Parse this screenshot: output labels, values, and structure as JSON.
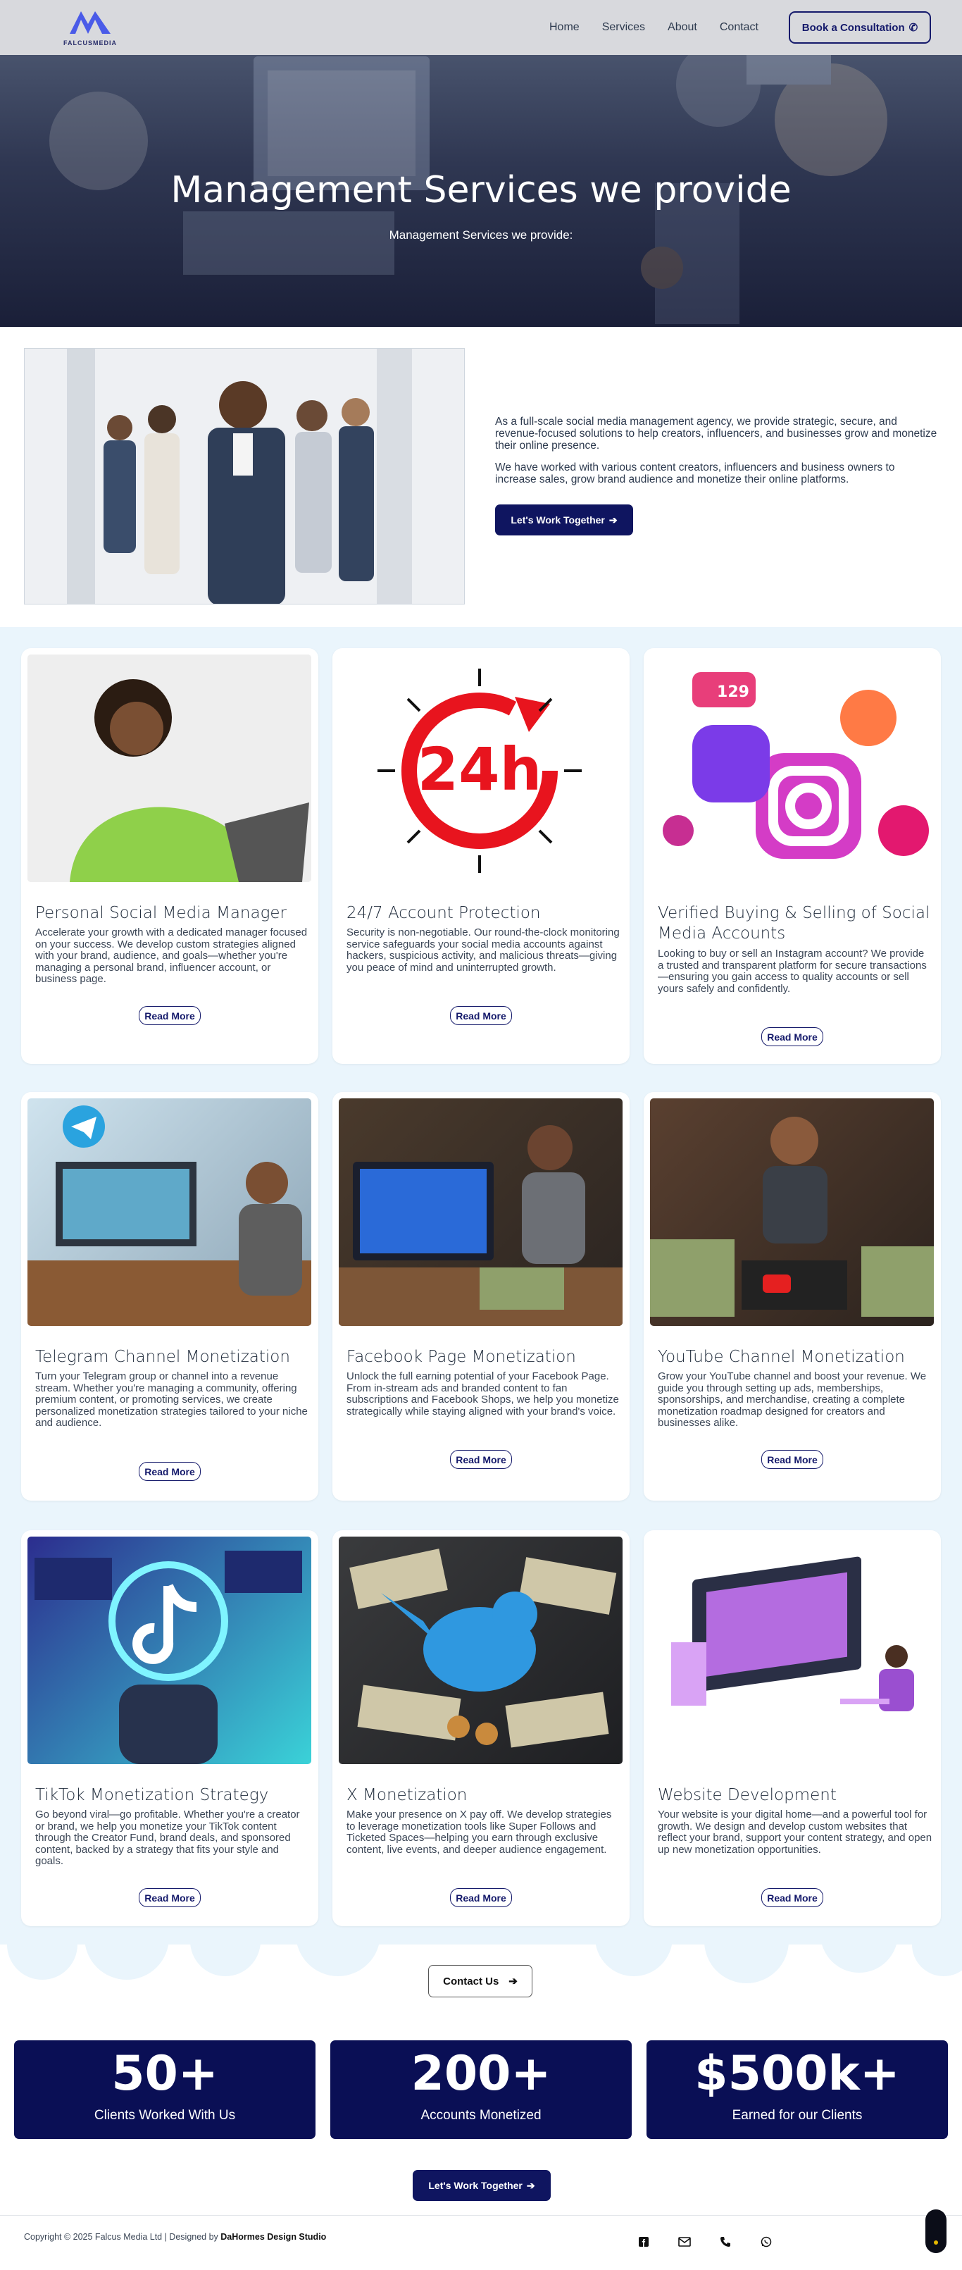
{
  "brand": {
    "logo_text": "FALCUSMEDIA",
    "accent": "#0f1560"
  },
  "nav": {
    "links": [
      "Home",
      "Services",
      "About",
      "Contact"
    ],
    "cta": "Book a Consultation"
  },
  "hero": {
    "title": "Management Services we provide",
    "subtitle": "Management Services we provide:"
  },
  "about": {
    "paragraph_1": "As a full-scale social media management agency, we provide strategic, secure, and revenue-focused solutions to help creators, influencers, and businesses grow and monetize their online presence.",
    "paragraph_2": "We have worked with various content creators, influencers and business owners to increase sales, grow brand audience and monetize their online platforms.",
    "button": "Let's Work Together"
  },
  "services": [
    {
      "title": "Personal Social Media Manager",
      "desc": "Accelerate your growth with a dedicated manager focused on your success. We develop custom strategies aligned with your brand, audience, and goals—whether you're managing a personal brand, influencer account, or business page.",
      "button": "Read More",
      "icon": "person-laptop"
    },
    {
      "title": "24/7 Account Protection",
      "desc": "Security is non-negotiable. Our round-the-clock monitoring service safeguards your social media accounts against hackers, suspicious activity, and malicious threats—giving you peace of mind and uninterrupted growth.",
      "button": "Read More",
      "icon": "clock-24h",
      "image_text": "24h"
    },
    {
      "title": "Verified Buying & Selling of Social Media Accounts",
      "desc": "Looking to buy or sell an Instagram account? We provide a trusted and transparent platform for secure transactions—ensuring you gain access to quality accounts or sell yours safely and confidently.",
      "button": "Read More",
      "icon": "instagram-3d",
      "image_text": "129"
    },
    {
      "title": "Telegram Channel Monetization",
      "desc": "Turn your Telegram group or channel into a revenue stream. Whether you're managing a community, offering premium content, or promoting services, we create personalized monetization strategies tailored to your niche and audience.",
      "button": "Read More",
      "icon": "telegram"
    },
    {
      "title": "Facebook Page Monetization",
      "desc": "Unlock the full earning potential of your Facebook Page. From in-stream ads and branded content to fan subscriptions and Facebook Shops, we help you monetize strategically while staying aligned with your brand's voice.",
      "button": "Read More",
      "icon": "facebook-laptop"
    },
    {
      "title": "YouTube Channel Monetization",
      "desc": "Grow your YouTube channel and boost your revenue. We guide you through setting up ads, memberships, sponsorships, and merchandise, creating a complete monetization roadmap designed for creators and businesses alike.",
      "button": "Read More",
      "icon": "youtube-studio"
    },
    {
      "title": "TikTok Monetization Strategy",
      "desc": "Go beyond viral—go profitable. Whether you're a creator or brand, we help you monetize your TikTok content through the Creator Fund, brand deals, and sponsored content, backed by a strategy that fits your style and goals.",
      "button": "Read More",
      "icon": "tiktok"
    },
    {
      "title": "X Monetization",
      "desc": "Make your presence on X pay off. We develop strategies to leverage monetization tools like Super Follows and Ticketed Spaces—helping you earn through exclusive content, live events, and deeper audience engagement.",
      "button": "Read More",
      "icon": "bird-money"
    },
    {
      "title": "Website Development",
      "desc": "Your website is your digital home—and a powerful tool for growth. We design and develop custom websites that reflect your brand, support your content strategy, and open up new monetization opportunities.",
      "button": "Read More",
      "icon": "web-dev"
    }
  ],
  "contact": {
    "button": "Contact Us"
  },
  "stats": [
    {
      "number": "50+",
      "label": "Clients Worked With Us"
    },
    {
      "number": "200+",
      "label": "Accounts Monetized"
    },
    {
      "number": "$500k+",
      "label": "Earned for our Clients"
    }
  ],
  "cta_bottom": "Let's Work Together",
  "footer": {
    "copyright": "Copyright © 2025 Falcus Media Ltd | Designed by ",
    "designer": "DaHormes Design Studio",
    "icons": [
      "facebook-icon",
      "email-icon",
      "phone-icon",
      "whatsapp-icon"
    ]
  }
}
